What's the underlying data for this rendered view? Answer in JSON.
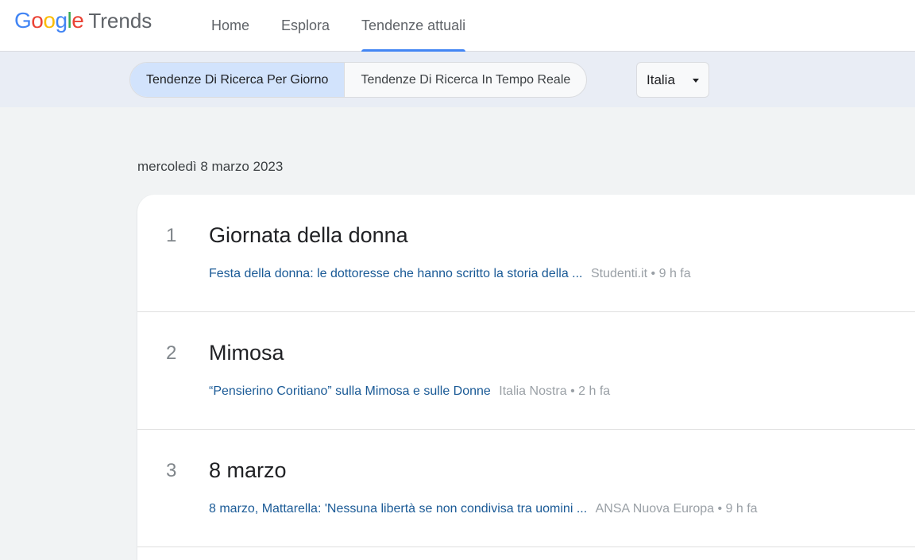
{
  "brand": {
    "logo_g": "Google",
    "logo_trends": "Trends"
  },
  "nav": {
    "tabs": [
      {
        "label": "Home"
      },
      {
        "label": "Esplora"
      },
      {
        "label": "Tendenze attuali",
        "active": true
      }
    ]
  },
  "subbar": {
    "segments": [
      {
        "label": "Tendenze Di Ricerca Per Giorno",
        "active": true
      },
      {
        "label": "Tendenze Di Ricerca In Tempo Reale"
      }
    ],
    "country": "Italia"
  },
  "date": "mercoledì 8 marzo 2023",
  "trends": [
    {
      "rank": "1",
      "title": "Giornata della donna",
      "headline": "Festa della donna: le dottoresse che hanno scritto la storia della ...",
      "meta": "Studenti.it • 9 h fa"
    },
    {
      "rank": "2",
      "title": "Mimosa",
      "headline": "“Pensierino Coritiano” sulla Mimosa e sulle Donne",
      "meta": "Italia Nostra • 2 h fa"
    },
    {
      "rank": "3",
      "title": "8 marzo",
      "headline": "8 marzo, Mattarella: 'Nessuna libertà se non condivisa tra uomini ...",
      "meta": "ANSA Nuova Europa • 9 h fa"
    }
  ],
  "colors": {
    "accent": "#4285f4",
    "headline": "#1a5a96",
    "logo": [
      "#4285f4",
      "#ea4335",
      "#fbbc05",
      "#4285f4",
      "#34a853",
      "#ea4335"
    ]
  }
}
